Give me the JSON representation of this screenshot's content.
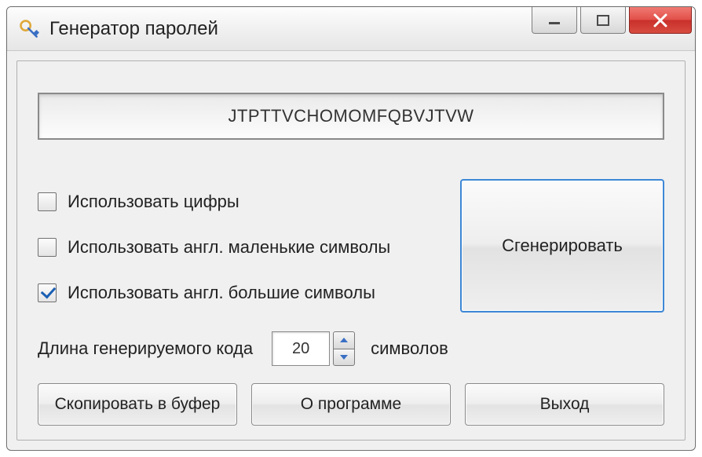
{
  "window": {
    "title": "Генератор паролей"
  },
  "output": {
    "password": "JTPTTVCHOMOMFQBVJTVW"
  },
  "options": {
    "use_digits": {
      "label": "Использовать цифры",
      "checked": false
    },
    "use_lowercase": {
      "label": "Использовать англ. маленькие символы",
      "checked": false
    },
    "use_uppercase": {
      "label": "Использовать англ. большие символы",
      "checked": true
    }
  },
  "generate": {
    "label": "Сгенерировать"
  },
  "length": {
    "label": "Длина генерируемого кода",
    "value": "20",
    "suffix": "символов"
  },
  "buttons": {
    "copy": "Скопировать в буфер",
    "about": "О программе",
    "exit": "Выход"
  }
}
